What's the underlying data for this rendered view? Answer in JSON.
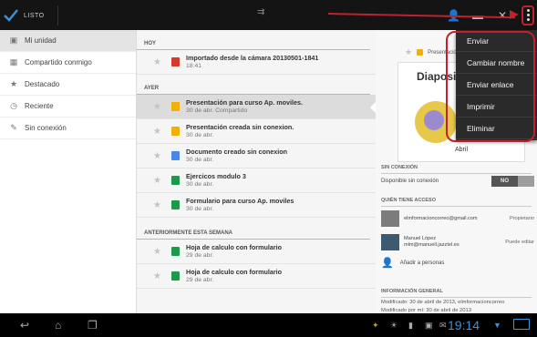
{
  "colors": {
    "accent_red": "#c0222b",
    "status_blue": "#3c90d8",
    "pres_yellow": "#f2b100",
    "sheet_green": "#1a9a4a",
    "doc_blue": "#4a86e8",
    "photo_red": "#d33a2c"
  },
  "topbar": {
    "done_label": "LISTO",
    "done_icon": "check-icon",
    "actions": [
      "add-person-icon",
      "folder-icon",
      "pin-icon",
      "overflow-menu-icon"
    ]
  },
  "nav": {
    "items": [
      {
        "label": "Mi unidad",
        "icon": "drive-icon"
      },
      {
        "label": "Compartido conmigo",
        "icon": "shared-icon"
      },
      {
        "label": "Destacado",
        "icon": "star-icon"
      },
      {
        "label": "Reciente",
        "icon": "clock-icon"
      },
      {
        "label": "Sin conexión",
        "icon": "pin-icon"
      }
    ]
  },
  "list": {
    "sections": [
      {
        "title": "HOY",
        "files": [
          {
            "title": "Importado desde la cámara 20130501-1841",
            "sub": "18:41",
            "type": "photo"
          }
        ]
      },
      {
        "title": "AYER",
        "files": [
          {
            "title": "Presentación para curso Ap. moviles.",
            "sub": "30 de abr.  Compartido",
            "type": "presentation"
          },
          {
            "title": "Presentación creada sin conexion.",
            "sub": "30 de abr.",
            "type": "presentation"
          },
          {
            "title": "Documento creado sin conexion",
            "sub": "30 de abr.",
            "type": "document"
          },
          {
            "title": "Ejercicos modulo 3",
            "sub": "30 de abr.",
            "type": "spreadsheet"
          },
          {
            "title": "Formulario para curso Ap. moviles",
            "sub": "30 de abr.",
            "type": "form"
          }
        ]
      },
      {
        "title": "ANTERIORMENTE ESTA SEMANA",
        "files": [
          {
            "title": "Hoja de calculo con formulario",
            "sub": "29 de abr.",
            "type": "spreadsheet"
          },
          {
            "title": "Hoja de calculo con formulario",
            "sub": "29 de abr.",
            "type": "spreadsheet"
          }
        ]
      }
    ]
  },
  "details": {
    "preview_label": "Presentación",
    "thumb_title": "Diapositi",
    "thumb_caption": "Abril",
    "offline": {
      "section": "SIN CONEXIÓN",
      "label": "Disponible sin conexión",
      "toggle": "NO"
    },
    "access": {
      "section": "QUIÉN TIENE ACCESO",
      "people": [
        {
          "name": "",
          "email": "elmformacioncorreo@gmail.com",
          "role": "Propietario"
        },
        {
          "name": "Manuel López",
          "email": "mlm@manuell.jazztel.es",
          "role": "Puede editar"
        }
      ],
      "add_label": "Añadir a personas"
    },
    "info": {
      "section": "INFORMACIÓN GENERAL",
      "modified": "Modificado: 30 de abril de 2013, elmformacioncorreo",
      "modified_by": "Modificado por mí: 30 de abril de 2013"
    }
  },
  "menu": {
    "items": [
      "Enviar",
      "Cambiar nombre",
      "Enviar enlace",
      "Imprimir",
      "Eliminar"
    ]
  },
  "sysbar": {
    "time": "19:14"
  }
}
